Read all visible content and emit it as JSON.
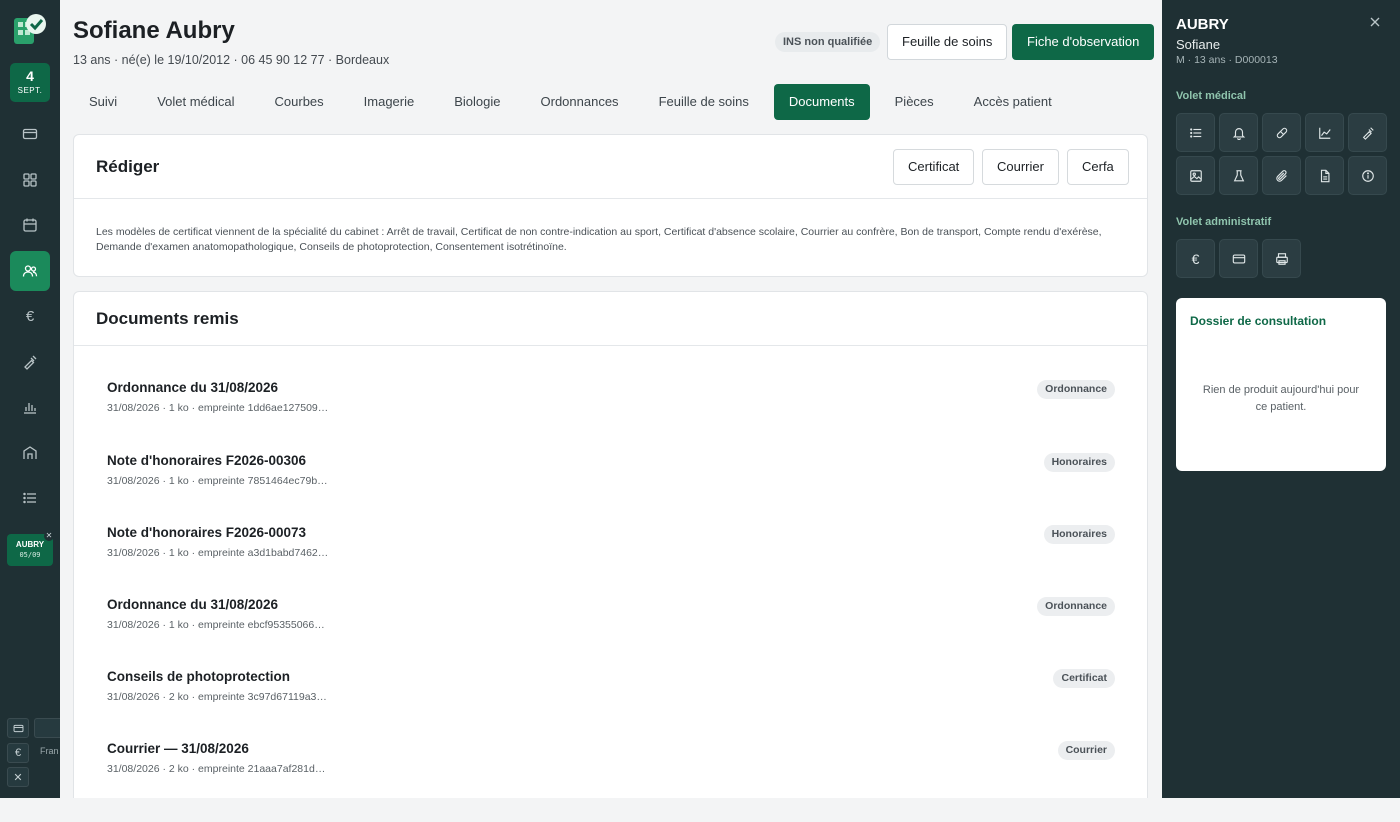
{
  "rail": {
    "date_day": "4",
    "date_month": "SEPT.",
    "patient_tab_name": "AUBRY",
    "patient_tab_date": "05/09",
    "mini_text": "Fran"
  },
  "header": {
    "name": "Sofiane Aubry",
    "info": "13 ans · né(e) le 19/10/2012 · 06 45 90 12 77 · Bordeaux",
    "ins_badge": "INS non qualifiée",
    "btn_feuille": "Feuille de soins",
    "btn_fiche": "Fiche d'observation"
  },
  "tabs": [
    "Suivi",
    "Volet médical",
    "Courbes",
    "Imagerie",
    "Biologie",
    "Ordonnances",
    "Feuille de soins",
    "Documents",
    "Pièces",
    "Accès patient"
  ],
  "active_tab": "Documents",
  "rediger": {
    "title": "Rédiger",
    "btn_certificat": "Certificat",
    "btn_courrier": "Courrier",
    "btn_cerfa": "Cerfa",
    "text": "Les modèles de certificat viennent de la spécialité du cabinet : Arrêt de travail, Certificat de non contre-indication au sport, Certificat d'absence scolaire, Courrier au confrère, Bon de transport, Compte rendu d'exérèse, Demande d'examen anatomopathologique, Conseils de photoprotection, Consentement isotrétinoïne."
  },
  "documents": {
    "title": "Documents remis",
    "items": [
      {
        "title": "Ordonnance du 31/08/2026",
        "meta": "31/08/2026 · 1 ko · empreinte 1dd6ae127509…",
        "badge": "Ordonnance"
      },
      {
        "title": "Note d'honoraires F2026-00306",
        "meta": "31/08/2026 · 1 ko · empreinte 7851464ec79b…",
        "badge": "Honoraires"
      },
      {
        "title": "Note d'honoraires F2026-00073",
        "meta": "31/08/2026 · 1 ko · empreinte a3d1babd7462…",
        "badge": "Honoraires"
      },
      {
        "title": "Ordonnance du 31/08/2026",
        "meta": "31/08/2026 · 1 ko · empreinte ebcf95355066…",
        "badge": "Ordonnance"
      },
      {
        "title": "Conseils de photoprotection",
        "meta": "31/08/2026 · 2 ko · empreinte 3c97d67119a3…",
        "badge": "Certificat"
      },
      {
        "title": "Courrier — 31/08/2026",
        "meta": "31/08/2026 · 2 ko · empreinte 21aaa7af281d…",
        "badge": "Courrier"
      }
    ]
  },
  "panel": {
    "name": "AUBRY",
    "firstname": "Sofiane",
    "sub": "M · 13 ans · D000013",
    "volet_medical": "Volet médical",
    "volet_admin": "Volet administratif",
    "dossier_title": "Dossier de consultation",
    "dossier_empty": "Rien de produit aujourd'hui pour ce patient."
  }
}
